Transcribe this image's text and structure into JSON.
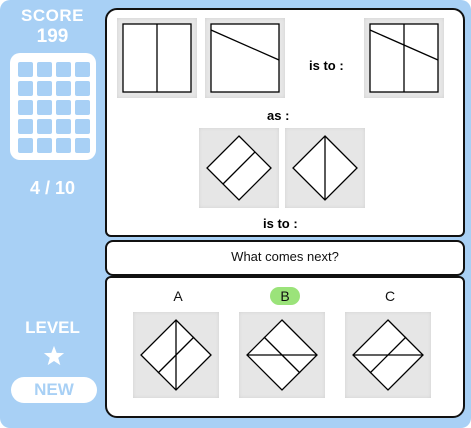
{
  "sidebar": {
    "score_label": "SCORE",
    "score_value": "199",
    "progress": "4 / 10",
    "level_label": "LEVEL",
    "level_badge": "NEW"
  },
  "puzzle": {
    "is_to_1": "is to :",
    "as": "as :",
    "is_to_2": "is to :",
    "question": "What comes next?"
  },
  "options": [
    {
      "label": "A",
      "selected": false
    },
    {
      "label": "B",
      "selected": true
    },
    {
      "label": "C",
      "selected": false
    }
  ],
  "colors": {
    "frame": "#a8d0f5",
    "selected": "#9be37a",
    "tile": "#e6e6e6"
  }
}
